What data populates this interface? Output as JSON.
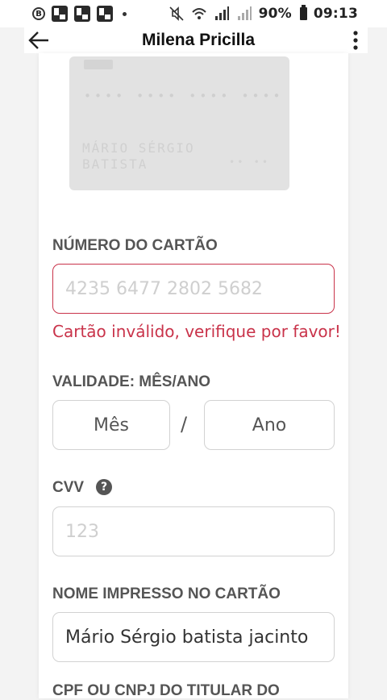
{
  "status_bar": {
    "battery": "90%",
    "time": "09:13"
  },
  "toolbar": {
    "title": "Milena Pricilla"
  },
  "card_preview": {
    "number_line1": "•••• •••• •••• ••••",
    "name_line1": "MÁRIO SÉRGIO",
    "name_line2": "BATISTA",
    "expiry": "•• ••"
  },
  "form": {
    "card_number": {
      "label": "NÚMERO DO CARTÃO",
      "placeholder": "4235 6477 2802 5682",
      "error": "Cartão inválido, verifique por favor!"
    },
    "expiry": {
      "label": "VALIDADE: MÊS/ANO",
      "month_placeholder": "Mês",
      "separator": "/",
      "year_placeholder": "Ano"
    },
    "cvv": {
      "label": "CVV",
      "placeholder": "123"
    },
    "name": {
      "label": "NOME IMPRESSO NO CARTÃO",
      "value": "Mário Sérgio batista jacinto"
    },
    "document": {
      "label": "CPF OU CNPJ DO TITULAR DO"
    }
  },
  "colors": {
    "error": "#c9334a",
    "border": "#d2d2d2",
    "label": "#555555"
  }
}
